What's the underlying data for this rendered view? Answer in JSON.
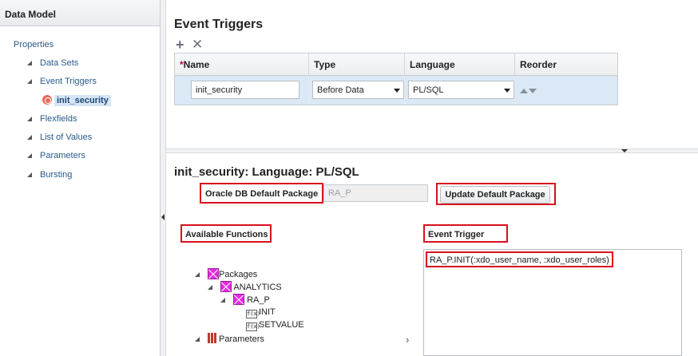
{
  "sidebar": {
    "title": "Data Model",
    "items": [
      {
        "label": "Properties"
      },
      {
        "label": "Data Sets"
      },
      {
        "label": "Event Triggers"
      },
      {
        "label": "init_security"
      },
      {
        "label": "Flexfields"
      },
      {
        "label": "List of Values"
      },
      {
        "label": "Parameters"
      },
      {
        "label": "Bursting"
      }
    ]
  },
  "triggers": {
    "title": "Event Triggers",
    "add_icon": "+",
    "delete_icon": "✕",
    "columns": {
      "required_mark": "*",
      "name": "Name",
      "type": "Type",
      "language": "Language",
      "reorder": "Reorder"
    },
    "row": {
      "name": "init_security",
      "type": "Before Data",
      "language": "PL/SQL"
    }
  },
  "detail": {
    "title": "init_security: Language: PL/SQL",
    "pkg_label": "Oracle DB Default Package",
    "pkg_value": "RA_P",
    "update_button": "Update Default Package",
    "available_label": "Available Functions",
    "event_label": "Event Trigger",
    "event_code": "RA_P.INIT(:xdo_user_name, :xdo_user_roles)",
    "tree": {
      "packages": "Packages",
      "analytics": "ANALYTICS",
      "ra_p": "RA_P",
      "init": "INIT",
      "setvalue": "SETVALUE",
      "parameters": "Parameters",
      "fx_icon": "f(x)"
    },
    "move_arrow": "›"
  },
  "colors": {
    "highlight_red": "#d8101e",
    "selected_row": "#dbe8f5",
    "link_blue": "#2a5a8a",
    "package_icon": "#e22ce0"
  }
}
